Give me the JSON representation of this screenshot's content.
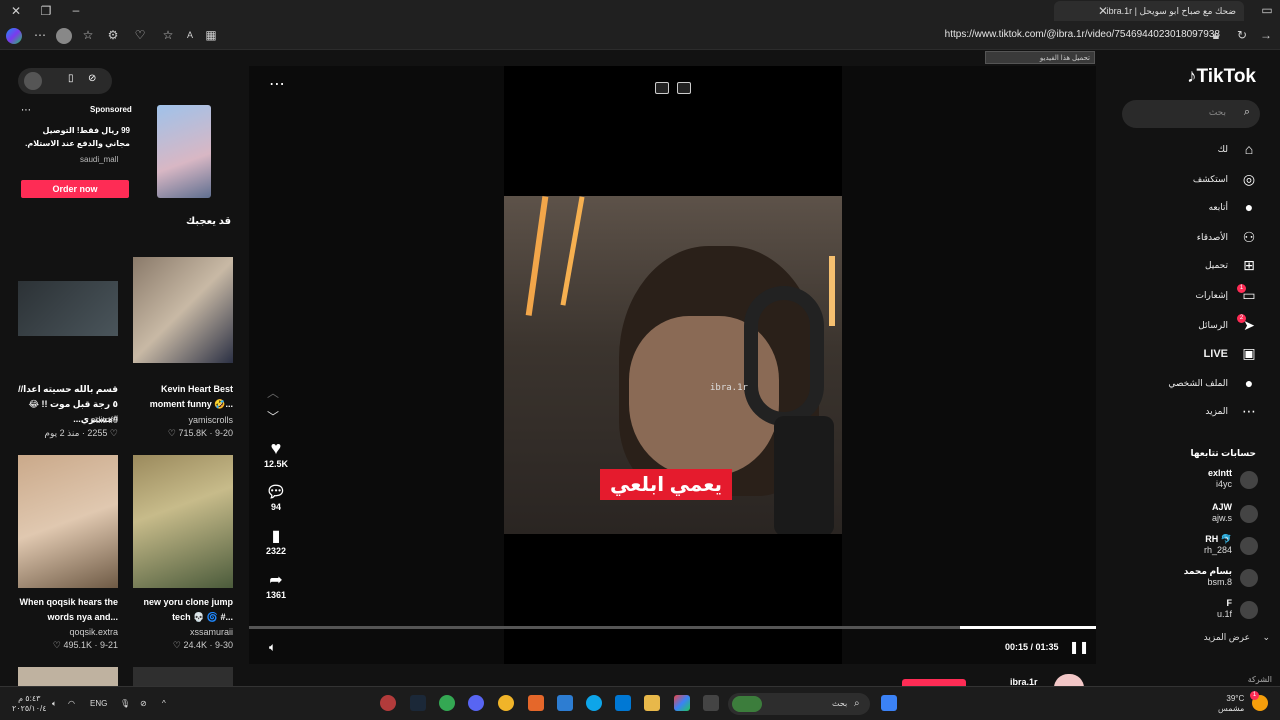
{
  "browser": {
    "tab_title": "ضحك مع صباح ابو سويحل | ibra.1r",
    "url": "https://www.tiktok.com/@ibra.1r/video/7546944023018097938",
    "translate_bar": "تحميل هذا الفيديو"
  },
  "sidebar": {
    "logo": "TikTok",
    "search_placeholder": "بحث",
    "nav": [
      {
        "label": "لك",
        "icon": "home-icon"
      },
      {
        "label": "استكشف",
        "icon": "compass-icon"
      },
      {
        "label": "أتابعه",
        "icon": "following-avatar-icon"
      },
      {
        "label": "الأصدقاء",
        "icon": "friends-icon"
      },
      {
        "label": "تحميل",
        "icon": "upload-icon"
      },
      {
        "label": "إشعارات",
        "icon": "inbox-icon",
        "badge": "1"
      },
      {
        "label": "الرسائل",
        "icon": "send-icon",
        "badge": "2"
      },
      {
        "label": "LIVE",
        "icon": "live-tv-icon"
      },
      {
        "label": "الملف الشخصي",
        "icon": "profile-avatar-icon"
      },
      {
        "label": "المزيد",
        "icon": "more-icon"
      }
    ],
    "following_header": "حسابات تتابعها",
    "following": [
      {
        "name": "exlntt",
        "handle": "i4yc"
      },
      {
        "name": "AJW",
        "handle": "ajw.s"
      },
      {
        "name": "RH 🐬",
        "handle": "rh_284"
      },
      {
        "name": "بسام محمد",
        "handle": "bsm.8"
      },
      {
        "name": "F",
        "handle": "u.1f"
      }
    ],
    "see_more": "عرض المزيد",
    "company": "الشركة"
  },
  "player": {
    "caption": "يعمي ابلعي",
    "watermark": "ibra.1r",
    "time": "00:15 / 01:35",
    "progress": 0.16,
    "likes": "12.5K",
    "comments": "94",
    "saves": "2322",
    "shares": "1361",
    "author": "ibra.1r"
  },
  "left": {
    "ad": {
      "sponsored": "Sponsored",
      "text": "99 ريال فقط! التوصيل مجاني والدفع عند الاستلام.",
      "account": "saudi_mall",
      "cta": "Order now"
    },
    "you_may_like": "قد يعجبك",
    "cards": [
      {
        "title": "Kevin Heart Best moment funny 🤣...",
        "user": "yamiscrolls",
        "meta": "♡ 715.8K · 9-20"
      },
      {
        "title": "قسم بالله حسيته اعدا//٥ رجة قبل موت !! 😂#مستري...",
        "user": "editrtf0",
        "meta": "♡ 2255 · منذ 2 يوم"
      },
      {
        "title": "new yoru clone jump tech 💀 🌀 #...",
        "user": "xssamuraii",
        "meta": "♡ 24.4K · 9-30"
      },
      {
        "title": "When qoqsik hears the words nya and...",
        "user": "qoqsik.extra",
        "meta": "♡ 495.1K · 9-21"
      }
    ]
  },
  "taskbar": {
    "search": "بحث",
    "lang": "ENG",
    "time": "٥:٤٣ م",
    "date": "٢٠٢٥/١٠/٤",
    "weather_temp": "39°C",
    "weather_text": "مشمس",
    "notif_count": "1"
  }
}
